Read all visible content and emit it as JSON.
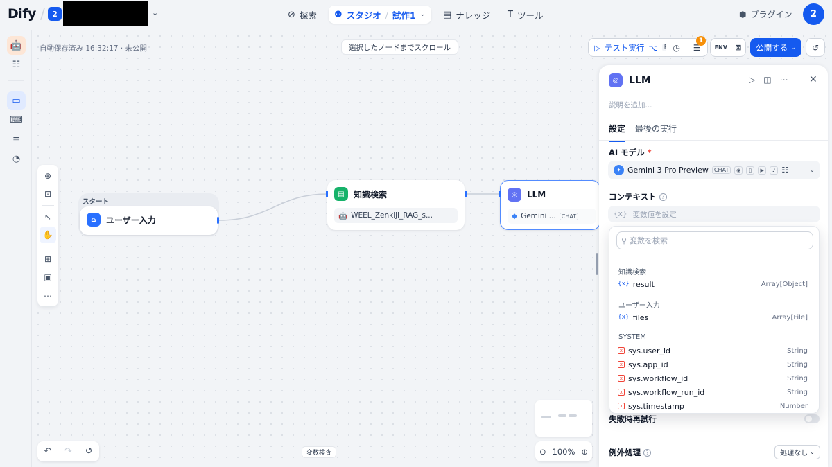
{
  "header": {
    "logo": "Dify",
    "workspace_badge": "2",
    "nav": {
      "explore": "探索",
      "studio": "スタジオ",
      "app_name": "試作1",
      "knowledge": "ナレッジ",
      "tools": "ツール"
    },
    "plugin": "プラグイン",
    "avatar": "2"
  },
  "canvas": {
    "autosave": "自動保存済み 16:32:17 · 未公開",
    "scroll_to_node": "選択したノードまでスクロール",
    "zoom": "100%",
    "var_inspect": "変数検査"
  },
  "toolbar": {
    "test_run": "テスト実行",
    "shortcut_1": "⌥",
    "shortcut_2": "R",
    "checklist_count": "1",
    "env": "ENV",
    "publish": "公開する"
  },
  "nodes": {
    "start": {
      "group_label": "スタート",
      "title": "ユーザー入力"
    },
    "knowledge": {
      "title": "知識検索",
      "dataset": "WEEL_Zenkiji_RAG_s..."
    },
    "llm": {
      "title": "LLM",
      "model": "Gemini ...",
      "chip": "CHAT"
    }
  },
  "panel": {
    "title": "LLM",
    "description_placeholder": "説明を追加...",
    "tabs": [
      "設定",
      "最後の実行"
    ],
    "model_label": "AI モデル",
    "model_name": "Gemini 3 Pro Preview",
    "model_chip": "CHAT",
    "context_label": "コンテキスト",
    "context_placeholder": "変数値を設定",
    "retry_label": "失敗時再試行",
    "exception_label": "例外処理",
    "exception_value": "処理なし"
  },
  "var_dropdown": {
    "search_placeholder": "変数を検索",
    "groups": [
      {
        "name": "知識検索",
        "vars": [
          {
            "name": "result",
            "type": "Array[Object]"
          }
        ]
      },
      {
        "name": "ユーザー入力",
        "vars": [
          {
            "name": "files",
            "type": "Array[File]"
          }
        ]
      },
      {
        "name": "SYSTEM",
        "vars": [
          {
            "name": "sys.user_id",
            "type": "String"
          },
          {
            "name": "sys.app_id",
            "type": "String"
          },
          {
            "name": "sys.workflow_id",
            "type": "String"
          },
          {
            "name": "sys.workflow_run_id",
            "type": "String"
          },
          {
            "name": "sys.timestamp",
            "type": "Number"
          }
        ]
      }
    ]
  },
  "colors": {
    "accent": "#155aef",
    "llm_node": "#6172f3",
    "knowledge_node": "#17b26a",
    "badge": "#f79009"
  }
}
